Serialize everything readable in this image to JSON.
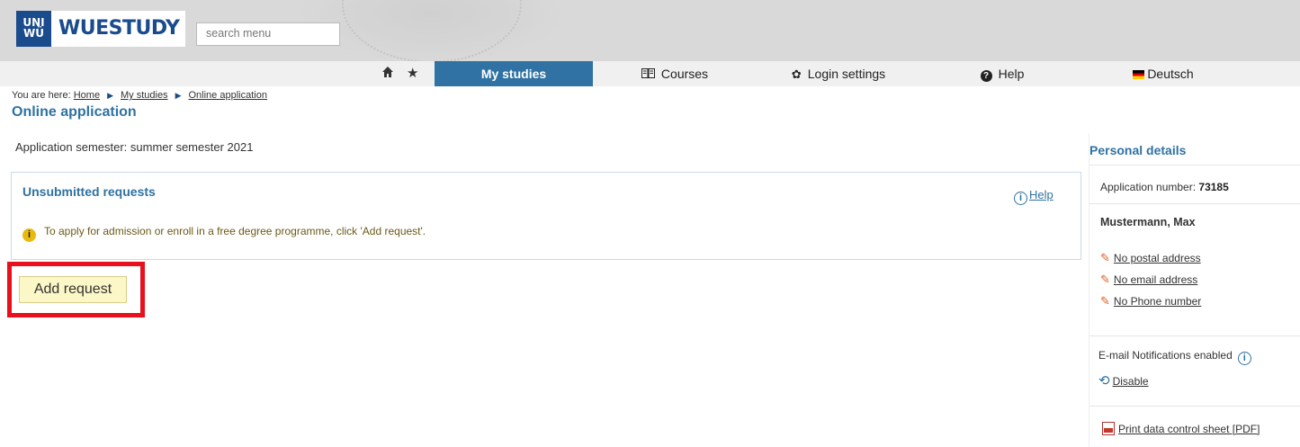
{
  "header": {
    "logo_uni": "UNI",
    "logo_wu": "WÜ",
    "logo_text": "WUESTUDY",
    "search_placeholder": "search menu"
  },
  "nav": {
    "home_icon": "home-icon",
    "favorites_icon": "star-icon",
    "items": [
      {
        "label": "My studies",
        "active": true
      },
      {
        "label": "Courses",
        "icon": "book-icon"
      },
      {
        "label": "Login settings",
        "icon": "gear-icon"
      },
      {
        "label": "Help",
        "icon": "question-icon"
      },
      {
        "label": "Deutsch",
        "icon": "german-flag-icon"
      }
    ]
  },
  "breadcrumb": {
    "prefix": "You are here:",
    "items": [
      "Home",
      "My studies",
      "Online application"
    ]
  },
  "page_title": "Online application",
  "semester": "Application semester: summer semester 2021",
  "requests_box": {
    "title": "Unsubmitted requests",
    "help_label": "Help",
    "info_text": "To apply for admission or enroll in a free degree programme, click 'Add request'."
  },
  "add_request_label": "Add request",
  "sidebar": {
    "title": "Personal details",
    "application_number_label": "Application number:",
    "application_number": "73185",
    "name": "Mustermann, Max",
    "links": [
      "No postal address",
      "No email address",
      "No Phone number"
    ],
    "notifications_text": "E-mail Notifications enabled",
    "disable_label": "Disable",
    "print_label": "Print data control sheet [PDF]"
  },
  "colors": {
    "accent": "#2f72a3",
    "highlight_frame": "#e8101d",
    "button_bg": "#fbf7c6"
  }
}
